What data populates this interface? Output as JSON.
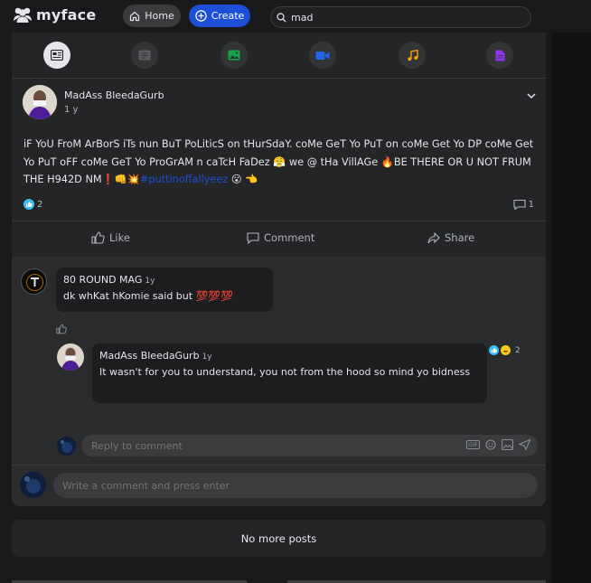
{
  "brand": {
    "name": "myface"
  },
  "nav": {
    "home_label": "Home",
    "create_label": "Create"
  },
  "search": {
    "value": "mad"
  },
  "colors": {
    "accent": "#1d4ed8",
    "background": "#18191a",
    "card": "#242526"
  },
  "tabs": [
    {
      "icon": "newsfeed-icon",
      "active": true,
      "color": "#e4e6eb"
    },
    {
      "icon": "text-post-icon",
      "active": false,
      "color": "#5a5b5e"
    },
    {
      "icon": "photo-icon",
      "active": false,
      "color": "#16a34a"
    },
    {
      "icon": "video-icon",
      "active": false,
      "color": "#2563eb"
    },
    {
      "icon": "music-icon",
      "active": false,
      "color": "#f59e0b"
    },
    {
      "icon": "document-icon",
      "active": false,
      "color": "#9333ea"
    }
  ],
  "post": {
    "author": "MadAss BleedaGurb",
    "time": "1 y",
    "text_part1": "iF YoU FroM ArBorS iTs nun BuT PoLiticS on tHurSdaY. coMe GeT Yo PuT on coMe Get Yo DP coMe Get Yo PuT oFF coMe GeT Yo ProGrAM n caTcH FaDez 😤 we @ tHa VillAGe 🔥BE THERE OR U NOT FRUM THE H942D NM❗👊💥",
    "hashtag": "#puttinoffallyeez",
    "text_part2": " 😮 👈",
    "like_count": "2",
    "comment_count": "1"
  },
  "actions": {
    "like": "Like",
    "comment": "Comment",
    "share": "Share"
  },
  "comments": [
    {
      "name": "80 ROUND MAG",
      "time": "1y",
      "text": "dk whKat hKomie said but 💯💯💯"
    }
  ],
  "reply": {
    "name": "MadAss BleedaGurb",
    "time": "1y",
    "text": "It wasn't for you to understand, you not from the hood so mind yo bidness",
    "reaction_count": "2"
  },
  "reply_input": {
    "placeholder": "Reply to comment",
    "gif_label": "GIF"
  },
  "comment_input": {
    "placeholder": "Write a comment and press enter"
  },
  "feed_end": {
    "label": "No more posts"
  }
}
